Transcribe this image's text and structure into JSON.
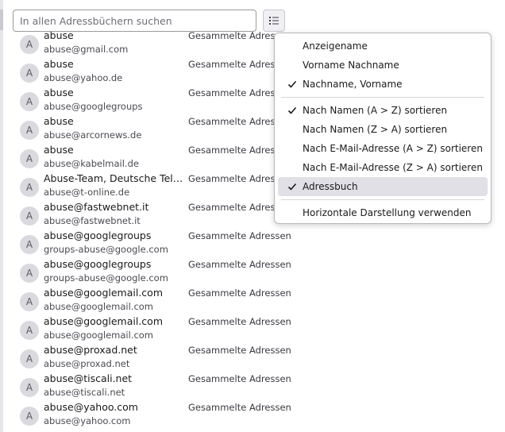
{
  "search": {
    "placeholder": "In allen Adressbüchern suchen"
  },
  "view_button": {
    "icon": "list-view-options-icon"
  },
  "contacts": [
    {
      "initial": "A",
      "name": "abuse",
      "email": "abuse@gmail.com",
      "book": "Gesammelte Adressen"
    },
    {
      "initial": "A",
      "name": "abuse",
      "email": "abuse@yahoo.de",
      "book": "Gesammelte Adressen"
    },
    {
      "initial": "A",
      "name": "abuse",
      "email": "abuse@googlegroups",
      "book": "Gesammelte Adressen"
    },
    {
      "initial": "A",
      "name": "abuse",
      "email": "abuse@arcornews.de",
      "book": "Gesammelte Adressen"
    },
    {
      "initial": "A",
      "name": "abuse",
      "email": "abuse@kabelmail.de",
      "book": "Gesammelte Adressen"
    },
    {
      "initial": "A",
      "name": "Abuse-Team, Deutsche Telekom",
      "email": "abuse@t-online.de",
      "book": "Gesammelte Adressen"
    },
    {
      "initial": "A",
      "name": "abuse@fastwebnet.it",
      "email": "abuse@fastwebnet.it",
      "book": "Gesammelte Adressen"
    },
    {
      "initial": "A",
      "name": "abuse@googlegroups",
      "email": "groups-abuse@google.com",
      "book": "Gesammelte Adressen"
    },
    {
      "initial": "A",
      "name": "abuse@googlegroups",
      "email": "groups-abuse@google.com",
      "book": "Gesammelte Adressen"
    },
    {
      "initial": "A",
      "name": "abuse@googlemail.com",
      "email": "abuse@googlemail.com",
      "book": "Gesammelte Adressen"
    },
    {
      "initial": "A",
      "name": "abuse@googlemail.com",
      "email": "abuse@googlemail.com",
      "book": "Gesammelte Adressen"
    },
    {
      "initial": "A",
      "name": "abuse@proxad.net",
      "email": "abuse@proxad.net",
      "book": "Gesammelte Adressen"
    },
    {
      "initial": "A",
      "name": "abuse@tiscali.net",
      "email": "abuse@tiscali.net",
      "book": "Gesammelte Adressen"
    },
    {
      "initial": "A",
      "name": "abuse@yahoo.com",
      "email": "abuse@yahoo.com",
      "book": "Gesammelte Adressen"
    }
  ],
  "menu": {
    "groups": [
      [
        {
          "label": "Anzeigename",
          "checked": false,
          "highlighted": false
        },
        {
          "label": "Vorname Nachname",
          "checked": false,
          "highlighted": false
        },
        {
          "label": "Nachname, Vorname",
          "checked": true,
          "highlighted": false
        }
      ],
      [
        {
          "label": "Nach Namen (A > Z) sortieren",
          "checked": true,
          "highlighted": false
        },
        {
          "label": "Nach Namen (Z > A) sortieren",
          "checked": false,
          "highlighted": false
        },
        {
          "label": "Nach E-Mail-Adresse (A > Z) sortieren",
          "checked": false,
          "highlighted": false
        },
        {
          "label": "Nach E-Mail-Adresse (Z > A) sortieren",
          "checked": false,
          "highlighted": false
        },
        {
          "label": "Adressbuch",
          "checked": true,
          "highlighted": true
        }
      ],
      [
        {
          "label": "Horizontale Darstellung verwenden",
          "checked": false,
          "highlighted": false
        }
      ]
    ]
  }
}
